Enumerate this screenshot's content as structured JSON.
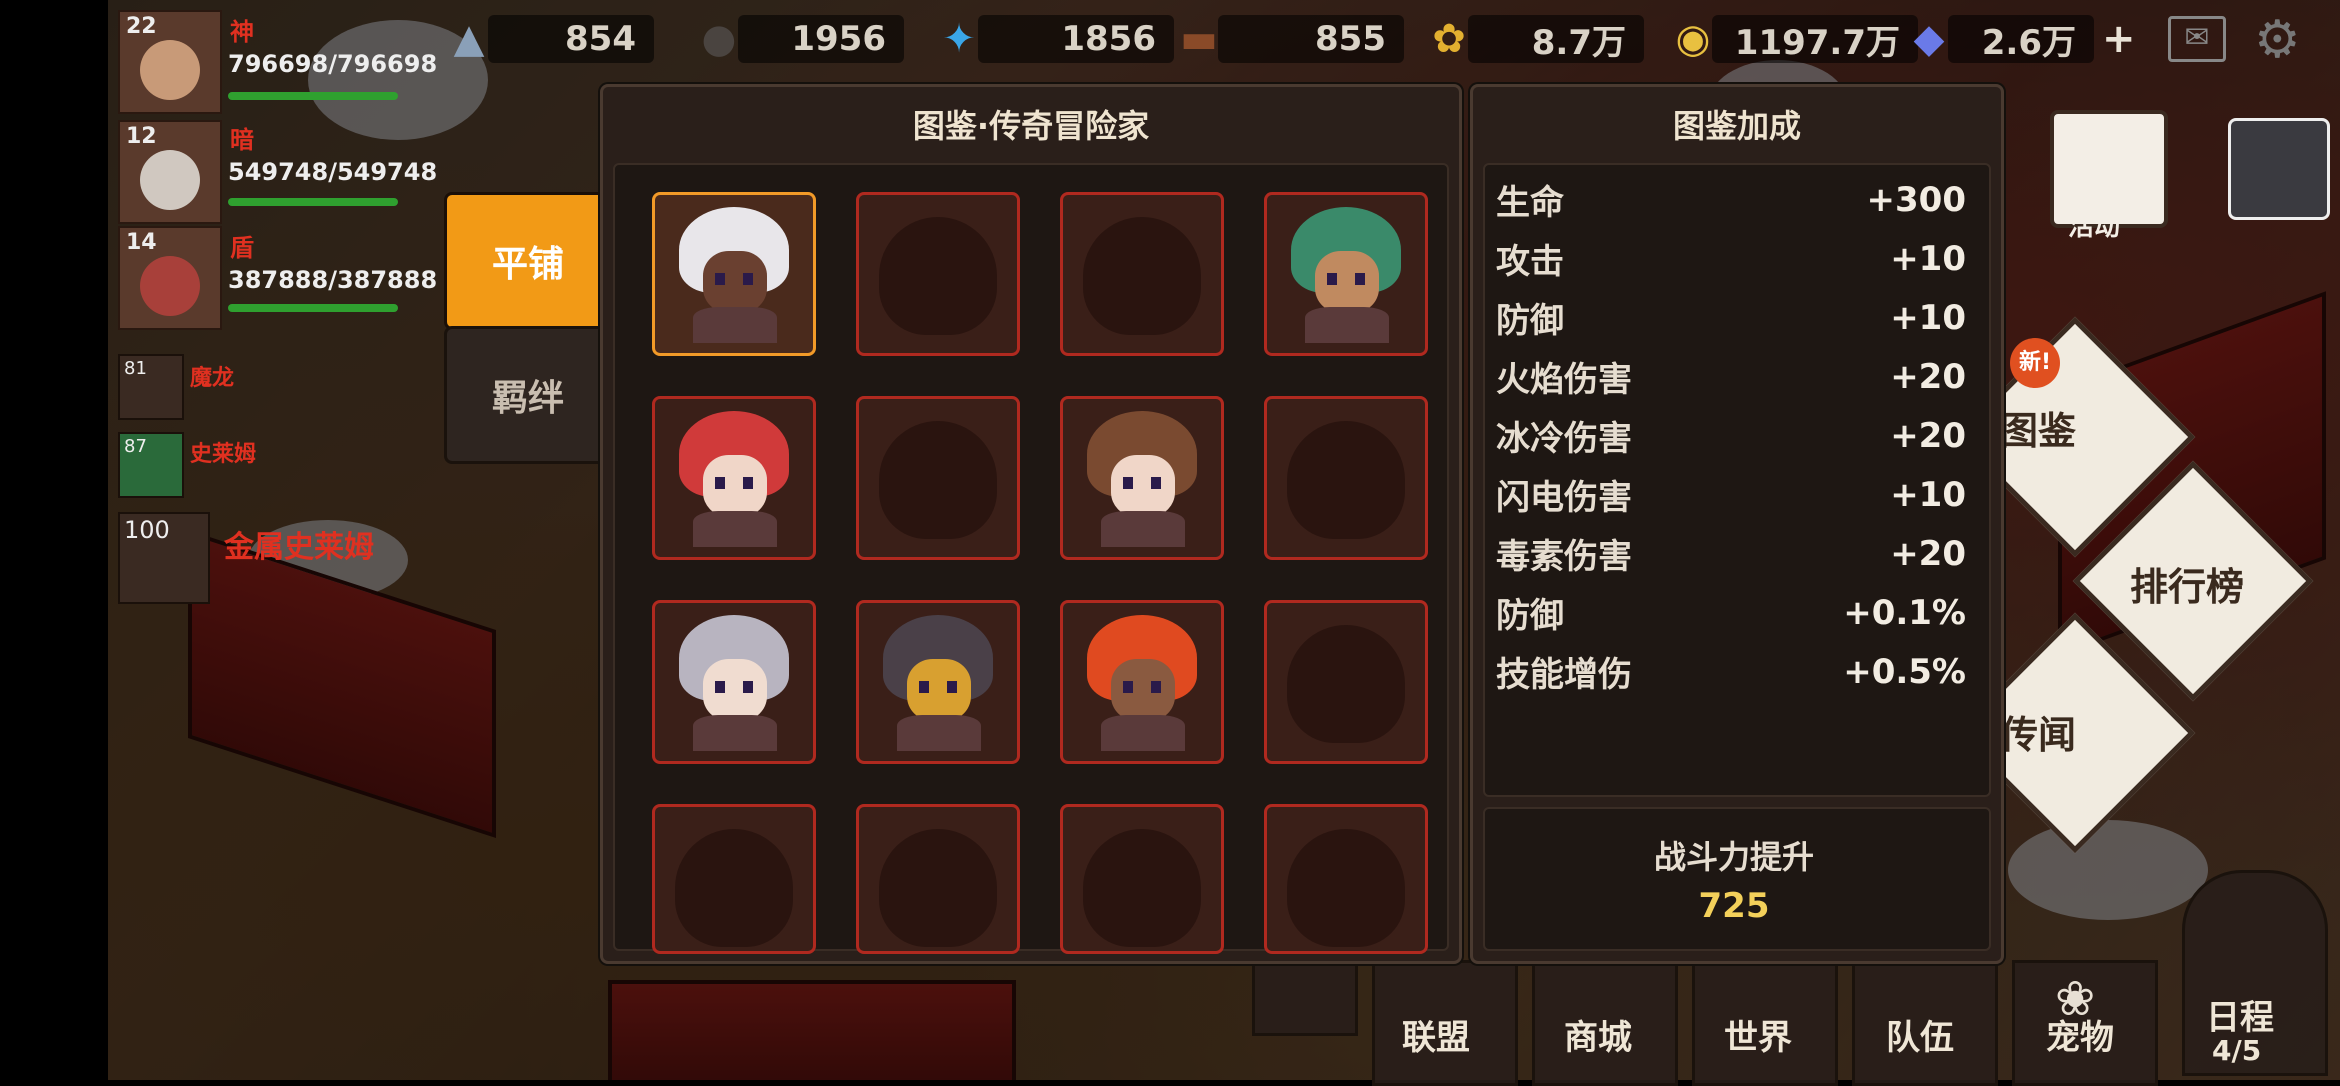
{
  "resources": [
    {
      "icon": "stone-icon",
      "value": "854"
    },
    {
      "icon": "ore-icon",
      "value": "1956"
    },
    {
      "icon": "crystal-icon",
      "value": "1856"
    },
    {
      "icon": "wood-icon",
      "value": "855"
    },
    {
      "icon": "wheat-icon",
      "value": "8.7万"
    },
    {
      "icon": "gold-coin-icon",
      "value": "1197.7万"
    },
    {
      "icon": "diamond-icon",
      "value": "2.6万"
    }
  ],
  "team": [
    {
      "level": "22",
      "name": "神",
      "hp": "796698/796698"
    },
    {
      "level": "12",
      "name": "暗",
      "hp": "549748/549748"
    },
    {
      "level": "14",
      "name": "盾",
      "hp": "387888/387888"
    }
  ],
  "pets": [
    {
      "level": "81",
      "name": "魔龙"
    },
    {
      "level": "87",
      "name": "史莱姆"
    },
    {
      "level": "100",
      "name": "金属史莱姆"
    }
  ],
  "right_menu": {
    "activity": "活动",
    "codex": "图鉴",
    "new_badge": "新!",
    "ranking": "排行榜",
    "legend": "传闻"
  },
  "bottom_menu": [
    "联盟",
    "商城",
    "世界",
    "队伍",
    "宠物",
    "日程"
  ],
  "schedule_count": "4/5",
  "tabs": {
    "tile": "平铺",
    "bond": "羁绊"
  },
  "codex": {
    "title": "图鉴·传奇冒险家",
    "cells": [
      {
        "state": "selected",
        "figure": "white-hair-adventurer"
      },
      {
        "state": "locked"
      },
      {
        "state": "locked"
      },
      {
        "state": "owned",
        "figure": "green-hair-adventurer"
      },
      {
        "state": "owned",
        "figure": "red-hair-adventurer"
      },
      {
        "state": "locked"
      },
      {
        "state": "owned",
        "figure": "brown-hair-adventurer"
      },
      {
        "state": "locked"
      },
      {
        "state": "owned",
        "figure": "silver-hood-adventurer"
      },
      {
        "state": "owned",
        "figure": "plague-doctor-adventurer"
      },
      {
        "state": "owned",
        "figure": "orange-hair-adventurer"
      },
      {
        "state": "locked"
      },
      {
        "state": "locked"
      },
      {
        "state": "locked"
      },
      {
        "state": "locked"
      },
      {
        "state": "locked"
      }
    ]
  },
  "bonus": {
    "title": "图鉴加成",
    "stats": [
      {
        "name": "生命",
        "value": "+300"
      },
      {
        "name": "攻击",
        "value": "+10"
      },
      {
        "name": "防御",
        "value": "+10"
      },
      {
        "name": "火焰伤害",
        "value": "+20"
      },
      {
        "name": "冰冷伤害",
        "value": "+20"
      },
      {
        "name": "闪电伤害",
        "value": "+10"
      },
      {
        "name": "毒素伤害",
        "value": "+20"
      },
      {
        "name": "防御",
        "value": "+0.1%"
      },
      {
        "name": "技能增伤",
        "value": "+0.5%"
      }
    ],
    "power_label": "战斗力提升",
    "power_value": "725"
  },
  "colors": {
    "accent": "#f29a16",
    "cell_border": "#b0291f",
    "selected_border": "#f29a28",
    "power": "#f3d05a"
  }
}
